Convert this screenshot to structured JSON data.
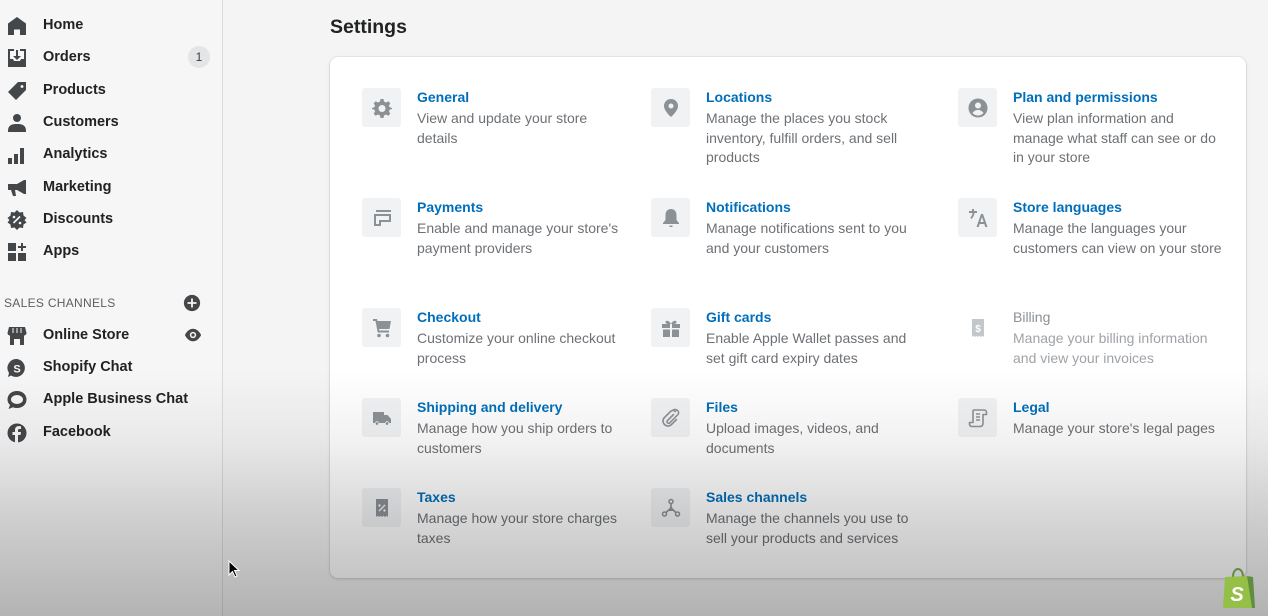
{
  "sidebar": {
    "nav": [
      {
        "label": "Home",
        "icon": "home-icon"
      },
      {
        "label": "Orders",
        "icon": "orders-icon",
        "badge": "1"
      },
      {
        "label": "Products",
        "icon": "tag-icon"
      },
      {
        "label": "Customers",
        "icon": "person-icon"
      },
      {
        "label": "Analytics",
        "icon": "bar-chart-icon"
      },
      {
        "label": "Marketing",
        "icon": "megaphone-icon"
      },
      {
        "label": "Discounts",
        "icon": "discount-icon"
      },
      {
        "label": "Apps",
        "icon": "apps-icon"
      }
    ],
    "sales_channels": {
      "heading": "SALES CHANNELS",
      "add_icon": "plus-circle-icon",
      "items": [
        {
          "label": "Online Store",
          "icon": "store-icon",
          "action_icon": "eye-icon"
        },
        {
          "label": "Shopify Chat",
          "icon": "shopify-chat-icon"
        },
        {
          "label": "Apple Business Chat",
          "icon": "chat-bubble-icon"
        },
        {
          "label": "Facebook",
          "icon": "facebook-icon"
        }
      ]
    }
  },
  "main": {
    "title": "Settings",
    "settings": [
      {
        "title": "General",
        "description": "View and update your store details",
        "icon": "gear-icon"
      },
      {
        "title": "Locations",
        "description": "Manage the places you stock inventory, fulfill orders, and sell products",
        "icon": "location-pin-icon"
      },
      {
        "title": "Plan and permissions",
        "description": "View plan information and manage what staff can see or do in your store",
        "icon": "user-circle-icon"
      },
      {
        "title": "Payments",
        "description": "Enable and manage your store's payment providers",
        "icon": "credit-card-icon"
      },
      {
        "title": "Notifications",
        "description": "Manage notifications sent to you and your customers",
        "icon": "bell-icon"
      },
      {
        "title": "Store languages",
        "description": "Manage the languages your customers can view on your store",
        "icon": "translate-icon"
      },
      {
        "title": "Checkout",
        "description": "Customize your online checkout process",
        "icon": "cart-icon"
      },
      {
        "title": "Gift cards",
        "description": "Enable Apple Wallet passes and set gift card expiry dates",
        "icon": "gift-icon"
      },
      {
        "title": "Billing",
        "description": "Manage your billing information and view your invoices",
        "icon": "billing-receipt-icon",
        "disabled": true
      },
      {
        "title": "Shipping and delivery",
        "description": "Manage how you ship orders to customers",
        "icon": "truck-icon"
      },
      {
        "title": "Files",
        "description": "Upload images, videos, and documents",
        "icon": "paperclip-icon"
      },
      {
        "title": "Legal",
        "description": "Manage your store's legal pages",
        "icon": "legal-scroll-icon"
      },
      {
        "title": "Taxes",
        "description": "Manage how your store charges taxes",
        "icon": "tax-receipt-icon"
      },
      {
        "title": "Sales channels",
        "description": "Manage the channels you use to sell your products and services",
        "icon": "sales-channels-icon"
      }
    ]
  },
  "colors": {
    "link": "#006fbb",
    "icon": "#8c9196",
    "shopify_green": "#95bf47"
  }
}
